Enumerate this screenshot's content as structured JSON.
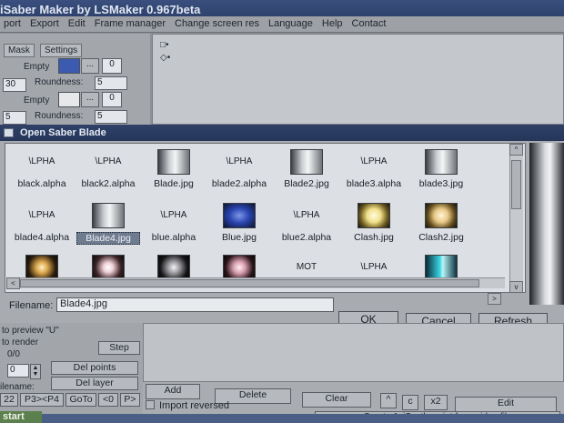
{
  "app": {
    "title": "iSaber Maker by LSMaker 0.967beta",
    "menu": [
      "port",
      "Export",
      "Edit",
      "Frame manager",
      "Change screen res",
      "Language",
      "Help",
      "Contact"
    ]
  },
  "top_panel": {
    "tabs": [
      "Mask",
      "Settings"
    ],
    "row1": {
      "empty_label": "Empty",
      "dots": "...",
      "value": "0",
      "field": "30",
      "roundness_label": "Roundness:",
      "roundness_value": "5"
    },
    "row2": {
      "empty_label": "Empty",
      "dots": "...",
      "value": "0",
      "field": "5",
      "roundness_label": "Roundness:",
      "roundness_value": "5"
    },
    "colors": {
      "swatch1": "#3c5bb0",
      "swatch2": "#e6e8ea"
    },
    "marks": [
      "□•",
      "◇•"
    ]
  },
  "dialog": {
    "title": "Open Saber Blade",
    "files": [
      {
        "thumb": "\\LPHA",
        "label": "black.alpha",
        "kind": "alpha"
      },
      {
        "thumb": "\\LPHA",
        "label": "black2.alpha",
        "kind": "alpha"
      },
      {
        "thumb": "",
        "label": "Blade.jpg",
        "kind": "blade"
      },
      {
        "thumb": "\\LPHA",
        "label": "blade2.alpha",
        "kind": "alpha"
      },
      {
        "thumb": "",
        "label": "Blade2.jpg",
        "kind": "blade"
      },
      {
        "thumb": "\\LPHA",
        "label": "blade3.alpha",
        "kind": "alpha"
      },
      {
        "thumb": "",
        "label": "blade3.jpg",
        "kind": "blade"
      },
      {
        "thumb": "\\LPHA",
        "label": "blade4.alpha",
        "kind": "alpha"
      },
      {
        "thumb": "",
        "label": "Blade4.jpg",
        "kind": "blade",
        "selected": true
      },
      {
        "thumb": "\\LPHA",
        "label": "blue.alpha",
        "kind": "alpha"
      },
      {
        "thumb": "",
        "label": "Blue.jpg",
        "kind": "blue"
      },
      {
        "thumb": "\\LPHA",
        "label": "blue2.alpha",
        "kind": "alpha"
      },
      {
        "thumb": "",
        "label": "Clash.jpg",
        "kind": "clash"
      },
      {
        "thumb": "",
        "label": "Clash2.jpg",
        "kind": "clash2"
      },
      {
        "thumb": "",
        "label": "",
        "kind": "glow-gold"
      },
      {
        "thumb": "",
        "label": "",
        "kind": "glow-white"
      },
      {
        "thumb": "",
        "label": "",
        "kind": "glow-soft"
      },
      {
        "thumb": "",
        "label": "",
        "kind": "glow-pink"
      },
      {
        "thumb": "MOT",
        "label": "",
        "kind": "alpha"
      },
      {
        "thumb": "\\LPHA",
        "label": "",
        "kind": "alpha"
      },
      {
        "thumb": "",
        "label": "",
        "kind": "cyan"
      }
    ],
    "filename_label": "Filename:",
    "filename_value": "Blade4.jpg",
    "buttons": {
      "ok": "OK",
      "cancel": "Cancel",
      "refresh": "Refresh"
    },
    "scroll_left": "<",
    "scroll_right": ">",
    "scroll_up": "^",
    "scroll_down": "v"
  },
  "bottom": {
    "auto_preview": "to preview \"U\"",
    "auto_render": "to render",
    "counter": "0/0",
    "stepper_value": "0",
    "step_label": "Step",
    "del_points": "Del points",
    "del_layer": "Del layer",
    "filename_label": "ilename:",
    "nav": [
      "22",
      "P3><P4",
      "GoTo",
      "<0",
      "P>"
    ],
    "add": "Add",
    "delete": "Delete",
    "import_reversed": "Import reversed",
    "clear": "Clear",
    "caret": "^",
    "c": "c",
    "x2": "x2",
    "edit": "Edit",
    "avisynth": "Create AviSynth script from video file",
    "start": "start"
  }
}
